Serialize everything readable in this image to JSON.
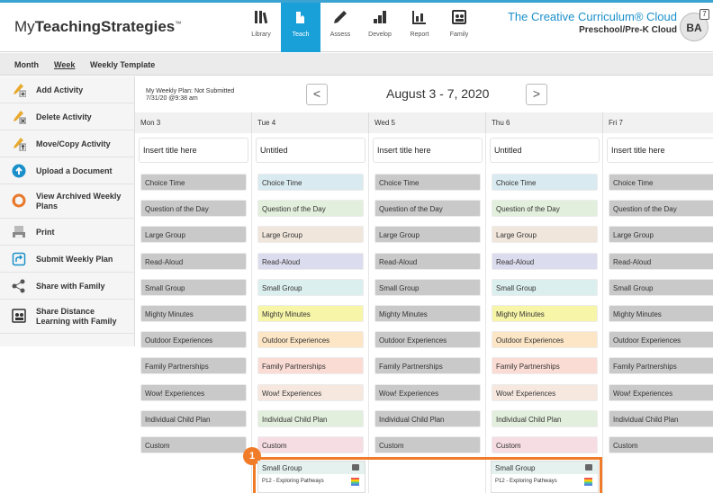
{
  "header": {
    "logo_pre": "My",
    "logo_bold": "TeachingStrategies",
    "logo_tm": "™",
    "nav": [
      {
        "label": "Library",
        "icon": "library-icon"
      },
      {
        "label": "Teach",
        "icon": "teach-icon",
        "active": true
      },
      {
        "label": "Assess",
        "icon": "pencil-icon"
      },
      {
        "label": "Develop",
        "icon": "develop-icon"
      },
      {
        "label": "Report",
        "icon": "report-icon"
      },
      {
        "label": "Family",
        "icon": "family-icon"
      }
    ],
    "brand_title": "The Creative Curriculum® Cloud",
    "brand_sub": "Preschool/Pre-K Cloud",
    "avatar": "BA",
    "badge": "7"
  },
  "subnav": {
    "month": "Month",
    "week": "Week",
    "template": "Weekly Template"
  },
  "sidebar": [
    {
      "label": "Add Activity",
      "icon": "add-activity-icon"
    },
    {
      "label": "Delete Activity",
      "icon": "delete-activity-icon"
    },
    {
      "label": "Move/Copy Activity",
      "icon": "move-copy-icon"
    },
    {
      "label": "Upload a Document",
      "icon": "upload-icon"
    },
    {
      "label": "View Archived Weekly Plans",
      "icon": "archive-icon"
    },
    {
      "label": "Print",
      "icon": "print-icon"
    },
    {
      "label": "Submit Weekly Plan",
      "icon": "submit-icon"
    },
    {
      "label": "Share with Family",
      "icon": "share-icon"
    },
    {
      "label": "Share Distance Learning with Family",
      "icon": "distance-learning-icon"
    }
  ],
  "week": {
    "plan_status": "My Weekly Plan: Not Submitted",
    "plan_time": "7/31/20 @9:38 am",
    "range": "August 3 - 7, 2020",
    "prev": "<",
    "next": ">"
  },
  "days": [
    {
      "name": "Mon 3",
      "title": "Insert title here"
    },
    {
      "name": "Tue 4",
      "title": "Untitled"
    },
    {
      "name": "Wed 5",
      "title": "Insert title here"
    },
    {
      "name": "Thu 6",
      "title": "Untitled"
    },
    {
      "name": "Fri 7",
      "title": "Insert title here"
    }
  ],
  "activities": [
    "Choice Time",
    "Question of the Day",
    "Large Group",
    "Read-Aloud",
    "Small Group",
    "Mighty Minutes",
    "Outdoor Experiences",
    "Family Partnerships",
    "Wow! Experiences",
    "Individual Child Plan",
    "Custom"
  ],
  "activity_colors": [
    "#d9eaf0",
    "#e2efdc",
    "#f0e6dc",
    "#dcdcef",
    "#dcefef",
    "#f7f5a8",
    "#fde6c6",
    "#fadcd4",
    "#f6e8df",
    "#e2efdc",
    "#f6dde3"
  ],
  "inactive_color": "#c9c9c9",
  "callout_number": "1",
  "cards": [
    {
      "title": "Small Group",
      "detail": "P12 - Exploring Pathways"
    },
    {
      "title": "Small Group",
      "detail": "P12 - Exploring Pathways"
    }
  ]
}
